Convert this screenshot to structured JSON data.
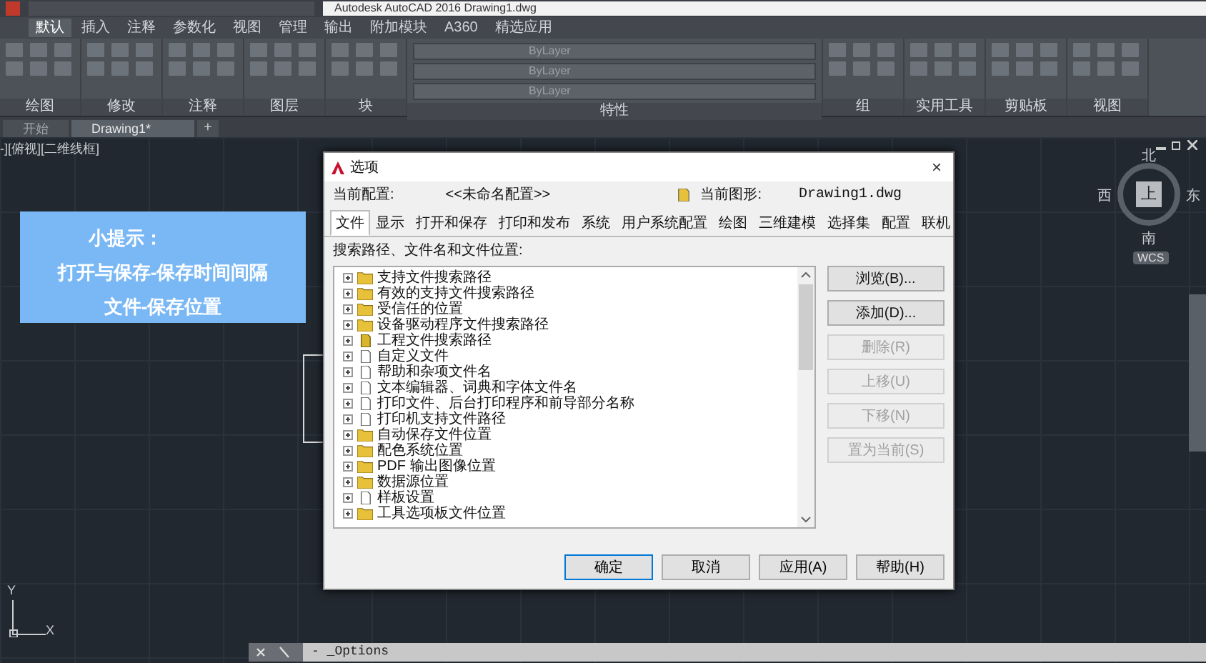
{
  "title_bar": {
    "title": "Autodesk AutoCAD 2016    Drawing1.dwg"
  },
  "ribbon": {
    "tabs": [
      {
        "label": "默认",
        "selected": true
      },
      {
        "label": "插入",
        "selected": false
      },
      {
        "label": "注释",
        "selected": false
      },
      {
        "label": "参数化",
        "selected": false
      },
      {
        "label": "视图",
        "selected": false
      },
      {
        "label": "管理",
        "selected": false
      },
      {
        "label": "输出",
        "selected": false
      },
      {
        "label": "附加模块",
        "selected": false
      },
      {
        "label": "A360",
        "selected": false
      },
      {
        "label": "精选应用",
        "selected": false
      }
    ],
    "panels": [
      {
        "kind": "tools",
        "label": "绘图"
      },
      {
        "kind": "tools",
        "label": "修改"
      },
      {
        "kind": "tools",
        "label": "注释"
      },
      {
        "kind": "tools",
        "label": "图层"
      },
      {
        "kind": "tools",
        "label": "块"
      },
      {
        "kind": "properties",
        "label": "特性",
        "dropdowns": [
          "ByLayer",
          "ByLayer",
          "ByLayer"
        ]
      },
      {
        "kind": "tools",
        "label": "组"
      },
      {
        "kind": "tools",
        "label": "实用工具"
      },
      {
        "kind": "tools",
        "label": "剪贴板"
      },
      {
        "kind": "tools",
        "label": "视图"
      }
    ]
  },
  "doc_tabs": [
    {
      "label": "开始",
      "selected": false
    },
    {
      "label": "Drawing1*",
      "selected": true
    }
  ],
  "new_tab": "+",
  "viewport": {
    "label": "-][俯视][二维线框]"
  },
  "tip": {
    "title": "小提示：",
    "lines": [
      "打开与保存-保存时间间隔",
      "文件-保存位置"
    ]
  },
  "viewcube": {
    "north": "北",
    "west": "西",
    "top": "上",
    "east": "东",
    "south": "南",
    "ucs": "WCS"
  },
  "ucs_icon": {
    "y": "Y",
    "x": "X"
  },
  "dialog": {
    "title": "选项",
    "close": "×",
    "current_profile_label": "当前配置:",
    "current_profile": "<<未命名配置>>",
    "current_drawing_label": "当前图形:",
    "current_drawing": "Drawing1.dwg",
    "tabs": [
      {
        "label": "文件",
        "selected": true
      },
      {
        "label": "显示",
        "selected": false
      },
      {
        "label": "打开和保存",
        "selected": false
      },
      {
        "label": "打印和发布",
        "selected": false
      },
      {
        "label": "系统",
        "selected": false
      },
      {
        "label": "用户系统配置",
        "selected": false
      },
      {
        "label": "绘图",
        "selected": false
      },
      {
        "label": "三维建模",
        "selected": false
      },
      {
        "label": "选择集",
        "selected": false
      },
      {
        "label": "配置",
        "selected": false
      },
      {
        "label": "联机",
        "selected": false
      }
    ],
    "list_label": "搜索路径、文件名和文件位置:",
    "tree": [
      {
        "kind": "folder",
        "label": "支持文件搜索路径",
        "expanded": false
      },
      {
        "kind": "folder",
        "label": "有效的支持文件搜索路径",
        "expanded": false
      },
      {
        "kind": "folder",
        "label": "受信任的位置",
        "expanded": false
      },
      {
        "kind": "folder",
        "label": "设备驱动程序文件搜索路径",
        "expanded": false
      },
      {
        "kind": "project",
        "label": "工程文件搜索路径",
        "expanded": false
      },
      {
        "kind": "file",
        "label": "自定义文件",
        "expanded": false
      },
      {
        "kind": "file",
        "label": "帮助和杂项文件名",
        "expanded": false
      },
      {
        "kind": "file",
        "label": "文本编辑器、词典和字体文件名",
        "expanded": false
      },
      {
        "kind": "file",
        "label": "打印文件、后台打印程序和前导部分名称",
        "expanded": false
      },
      {
        "kind": "file",
        "label": "打印机支持文件路径",
        "expanded": false
      },
      {
        "kind": "folder",
        "label": "自动保存文件位置",
        "expanded": false
      },
      {
        "kind": "folder",
        "label": "配色系统位置",
        "expanded": false
      },
      {
        "kind": "folder",
        "label": "PDF 输出图像位置",
        "expanded": false
      },
      {
        "kind": "folder",
        "label": "数据源位置",
        "expanded": false
      },
      {
        "kind": "file",
        "label": "样板设置",
        "expanded": false
      },
      {
        "kind": "folder",
        "label": "工具选项板文件位置",
        "expanded": false
      }
    ],
    "side_buttons": [
      {
        "label": "浏览(B)...",
        "disabled": false
      },
      {
        "label": "添加(D)...",
        "disabled": false
      },
      {
        "label": "删除(R)",
        "disabled": true
      },
      {
        "label": "上移(U)",
        "disabled": true
      },
      {
        "label": "下移(N)",
        "disabled": true
      },
      {
        "label": "置为当前(S)",
        "disabled": true
      }
    ],
    "buttons": [
      {
        "label": "确定",
        "selected": true
      },
      {
        "label": "取消",
        "selected": false
      },
      {
        "label": "应用(A)",
        "selected": false
      },
      {
        "label": "帮助(H)",
        "selected": false
      }
    ]
  },
  "command_line": {
    "value": "- _Options"
  }
}
